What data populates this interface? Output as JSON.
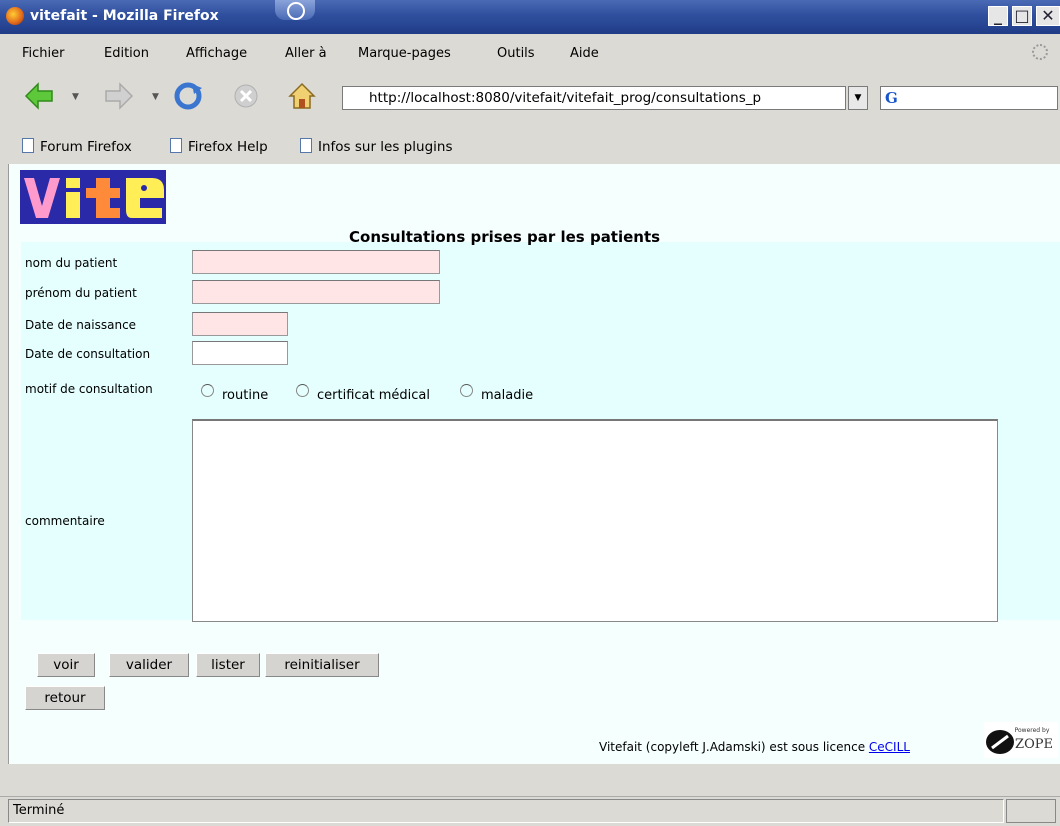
{
  "window": {
    "title": "vitefait - Mozilla Firefox"
  },
  "menu": [
    "Fichier",
    "Edition",
    "Affichage",
    "Aller à",
    "Marque-pages",
    "Outils",
    "Aide"
  ],
  "toolbar": {
    "url": "http://localhost:8080/vitefait/vitefait_prog/consultations_p"
  },
  "bookmarks": [
    "Forum Firefox",
    "Firefox Help",
    "Infos sur les plugins"
  ],
  "page": {
    "logo_text": "Vite",
    "title": "Consultations prises par les patients",
    "fields": {
      "nom_label": "nom du patient",
      "prenom_label": "prénom du patient",
      "naissance_label": "Date de naissance",
      "consultation_label": "Date de consultation",
      "motif_label": "motif de consultation",
      "commentaire_label": "commentaire"
    },
    "motif_options": [
      "routine",
      "certificat médical",
      "maladie"
    ],
    "buttons": {
      "voir": "voir",
      "valider": "valider",
      "lister": "lister",
      "reinitialiser": "reinitialiser",
      "retour": "retour"
    },
    "footer": {
      "text": "Vitefait (copyleft J.Adamski) est sous licence ",
      "link": "CeCILL",
      "badge_small": "Powered by",
      "badge": "ZOPE"
    }
  },
  "status": {
    "text": "Terminé"
  }
}
